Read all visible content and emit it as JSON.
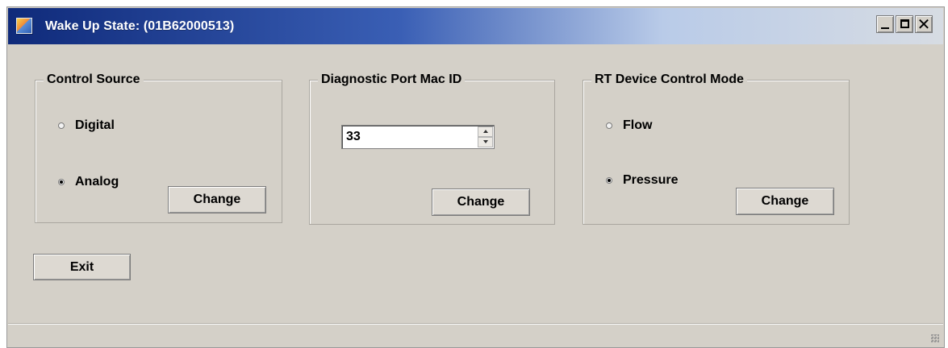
{
  "window": {
    "title": "Wake Up State: (01B62000513)",
    "controls": {
      "minimize": "_",
      "maximize": "□",
      "close": "✕"
    }
  },
  "control_source": {
    "label": "Control Source",
    "options": [
      {
        "label": "Digital",
        "selected": false
      },
      {
        "label": "Analog",
        "selected": true
      }
    ],
    "change_label": "Change"
  },
  "diagnostic_port_mac_id": {
    "label": "Diagnostic Port Mac ID",
    "value": "33",
    "change_label": "Change"
  },
  "rt_device_control_mode": {
    "label": "RT Device Control Mode",
    "options": [
      {
        "label": "Flow",
        "selected": false
      },
      {
        "label": "Pressure",
        "selected": true
      }
    ],
    "change_label": "Change"
  },
  "footer": {
    "exit_label": "Exit"
  },
  "icons": {
    "app": "app-icon",
    "minimize": "minimize-icon",
    "maximize": "maximize-icon",
    "close": "close-icon",
    "spin_up": "spin-up-icon",
    "spin_down": "spin-down-icon",
    "resize_grip": "resize-grip-icon"
  },
  "colors": {
    "window_bg": "#d4d0c8",
    "titlebar_start": "#0f2a7a",
    "titlebar_end": "#d7dce3",
    "text": "#000000"
  }
}
